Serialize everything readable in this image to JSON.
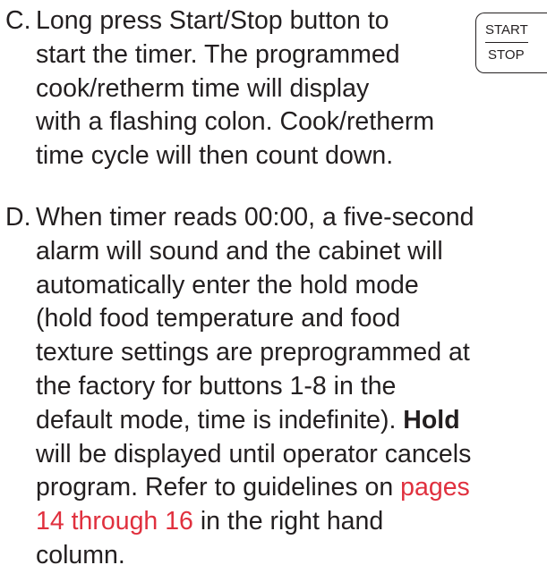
{
  "step_c": {
    "marker": "C.",
    "lines": [
      "Long press Start/Stop button to",
      "start the timer. The programmed",
      "cook/retherm time will display",
      "with a flashing colon. Cook/retherm",
      "time cycle will then count down."
    ]
  },
  "start_stop_key": {
    "top_label": "START",
    "bottom_label": "STOP"
  },
  "step_d": {
    "marker": "D.",
    "lines": [
      "When timer reads 00:00, a five-second",
      "alarm will sound and the cabinet will",
      "automatically enter the hold mode",
      "(hold food temperature and food",
      "texture settings are preprogrammed at",
      "the factory for buttons 1-8 in the",
      "default mode, time is indefinite)."
    ],
    "hold_bold": "Hold",
    "hold_rest": "will be displayed until operator cancels",
    "line_9_pre": "program. Refer to guidelines on",
    "link_part1": "pages",
    "link_part2": "14 through 16",
    "line_10_rest": "in the right hand",
    "line_11": "column."
  },
  "colors": {
    "text": "#231f20",
    "link": "#e0303e"
  }
}
